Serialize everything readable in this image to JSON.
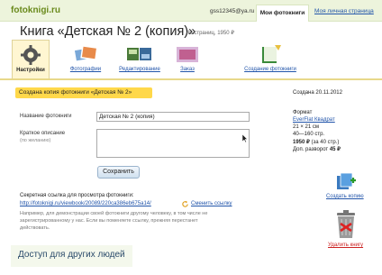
{
  "topbar": {
    "logo": "fotoknigi.ru",
    "user_email": "gss12345@ya.ru",
    "nav_my_books": "Мои фотокниги",
    "nav_account": "Моя личная страница"
  },
  "header": {
    "title": "Книга «Детская № 2 (копия)»",
    "meta": "40 страниц, 1950 ₽"
  },
  "tabs": [
    {
      "label": "Настройки",
      "icon": "gear-icon",
      "active": true
    },
    {
      "label": "Фотографии",
      "icon": "photos-icon",
      "active": false
    },
    {
      "label": "Редактирование",
      "icon": "edit-pages-icon",
      "active": false
    },
    {
      "label": "Заказ",
      "icon": "order-icon",
      "active": false
    },
    {
      "label": "Создание фотокниги",
      "icon": "create-book-icon",
      "active": false
    }
  ],
  "banner": {
    "text": "Создана копия фотокниги «Детская № 2»"
  },
  "form": {
    "name_label": "Название фотокниги",
    "name_value": "Детская № 2 (копия)",
    "desc_label": "Краткое описание",
    "desc_hint": "(по желанию)",
    "desc_value": "",
    "save_label": "Сохранить"
  },
  "secret": {
    "label": "Секретная ссылка для просмотра фотокниги:",
    "url": "http://fotoknigi.ru/viewbook/20089/220ca386eb675a14/",
    "change_label": "Сменить ссылку",
    "note": "Например, для демонстрации своей фотокниги другому человеку, в том числе не зарегистрированному у нас. Если вы поменяете ссылку, прежняя перестанет действовать."
  },
  "access": {
    "title": "Доступ для других людей"
  },
  "sidebar": {
    "created": "Создана 20.11.2012",
    "format_title": "Формат",
    "format_name": "EverFlat Квадрат",
    "size": "21 × 21 см",
    "pages": "40—160 стр.",
    "price_bold": "1950 ₽",
    "price_rest": " (за 40 стр.)",
    "extra_prefix": "Доп. разворот ",
    "extra_bold": "45 ₽",
    "copy_label": "Создать копию",
    "delete_label": "Удалить книгу"
  },
  "colors": {
    "accent_green": "#6a8a1c",
    "banner_yellow": "#ffd84a",
    "link_blue": "#2255aa",
    "delete_red": "#cc2222"
  }
}
